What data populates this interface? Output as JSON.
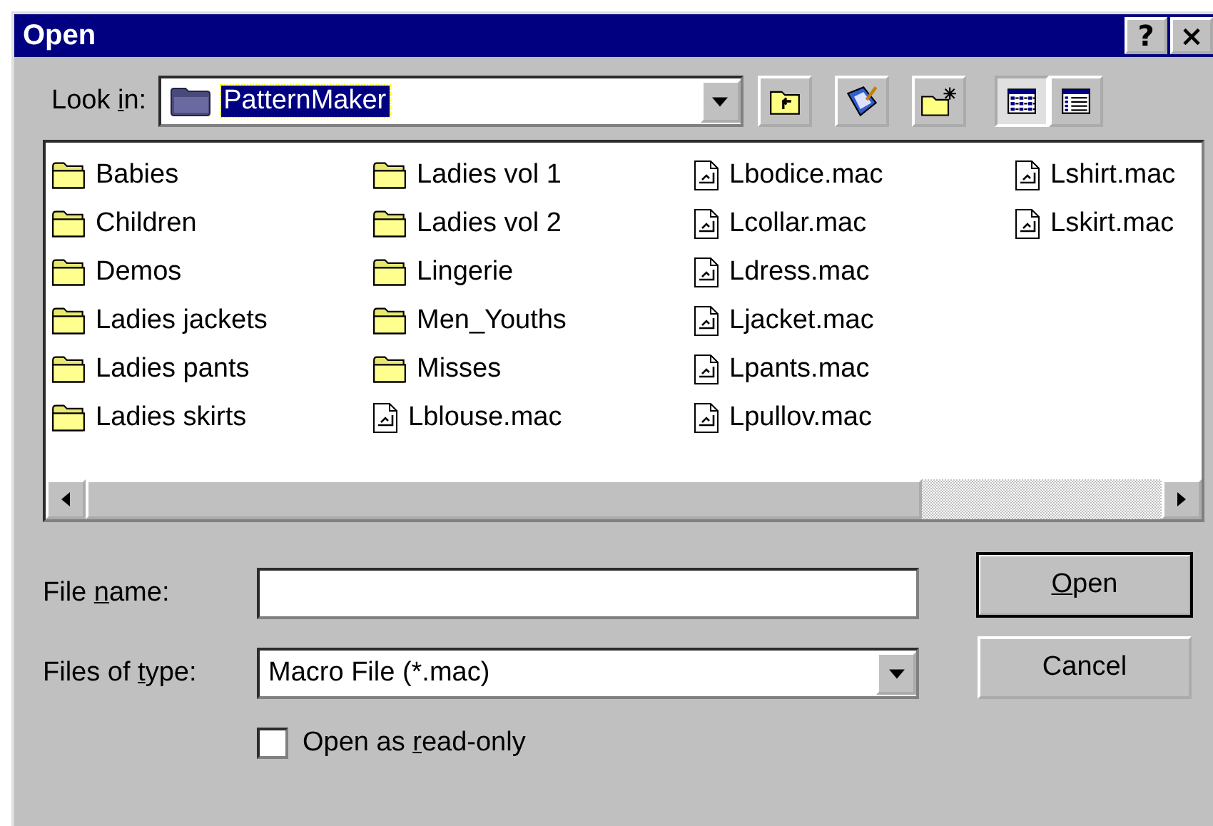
{
  "window": {
    "title": "Open",
    "title_buttons": [
      "?",
      "×"
    ]
  },
  "look_in": {
    "label": {
      "pre": "Look ",
      "key": "i",
      "post": "n:"
    },
    "value": "PatternMaker",
    "selected": true
  },
  "toolbar": [
    {
      "kind": "up-folder"
    },
    {
      "kind": "desktop"
    },
    {
      "kind": "new-folder"
    },
    {
      "kind": "list-view",
      "selected": true
    },
    {
      "kind": "details-view",
      "selected": false
    }
  ],
  "files": [
    {
      "kind": "folder",
      "name": "Babies"
    },
    {
      "kind": "folder",
      "name": "Children"
    },
    {
      "kind": "folder",
      "name": "Demos"
    },
    {
      "kind": "folder",
      "name": "Ladies jackets"
    },
    {
      "kind": "folder",
      "name": "Ladies pants"
    },
    {
      "kind": "folder",
      "name": "Ladies skirts"
    },
    {
      "kind": "folder",
      "name": "Ladies vol 1"
    },
    {
      "kind": "folder",
      "name": "Ladies vol 2"
    },
    {
      "kind": "folder",
      "name": "Lingerie"
    },
    {
      "kind": "folder",
      "name": "Men_Youths"
    },
    {
      "kind": "folder",
      "name": "Misses"
    },
    {
      "kind": "file",
      "name": "Lblouse.mac"
    },
    {
      "kind": "file",
      "name": "Lbodice.mac"
    },
    {
      "kind": "file",
      "name": "Lcollar.mac"
    },
    {
      "kind": "file",
      "name": "Ldress.mac"
    },
    {
      "kind": "file",
      "name": "Ljacket.mac"
    },
    {
      "kind": "file",
      "name": "Lpants.mac"
    },
    {
      "kind": "file",
      "name": "Lpullov.mac"
    },
    {
      "kind": "file",
      "name": "Lshirt.mac"
    },
    {
      "kind": "file",
      "name": "Lskirt.mac"
    }
  ],
  "file_name": {
    "label": {
      "pre": "File ",
      "key": "n",
      "post": "ame:"
    }
  },
  "file_type": {
    "label": {
      "pre": "Files of ",
      "key": "t",
      "post": "ype:"
    },
    "value": "Macro File (*.mac)"
  },
  "read_only": {
    "label": {
      "pre": "Open as ",
      "key": "r",
      "post": "ead-only"
    },
    "checked": false
  },
  "buttons": [
    {
      "label": {
        "key": "O",
        "post": "pen"
      },
      "default": true
    },
    {
      "label": {
        "pre": "Cancel"
      },
      "default": false
    }
  ]
}
